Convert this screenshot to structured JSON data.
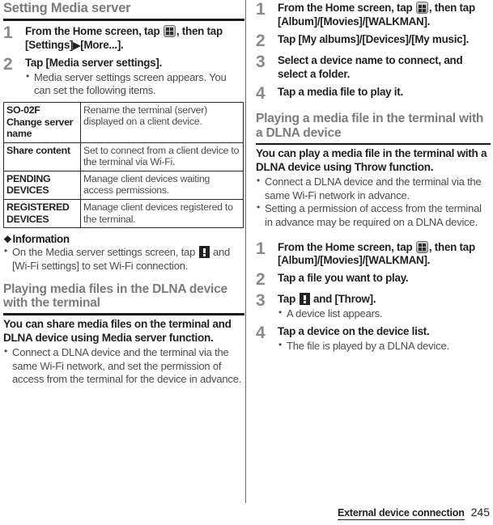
{
  "left_column": {
    "section_title": "Setting Media server",
    "steps": [
      {
        "num": "1",
        "text_parts": {
          "before_icon": "From the Home screen, tap ",
          "icon": "apps-grid-icon",
          "after_icon": ", then tap [Settings]",
          "arrow": "▶",
          "tail": "[More...]."
        }
      },
      {
        "num": "2",
        "text": "Tap [Media server settings].",
        "bullets": [
          "Media server settings screen appears. You can set the following items."
        ]
      }
    ],
    "table": {
      "rows": [
        {
          "key": "SO-02F Change server name",
          "value": "Rename the terminal (server) displayed on a client device."
        },
        {
          "key": "Share content",
          "value": "Set to connect from a client device to the terminal via Wi-Fi."
        },
        {
          "key": "PENDING DEVICES",
          "value": "Manage client devices waiting access permissions."
        },
        {
          "key": "REGISTERED DEVICES",
          "value": "Manage client devices registered to the terminal."
        }
      ]
    },
    "information": {
      "heading": "Information",
      "diamond": "❖",
      "bullet_parts": {
        "before_icon": "On the Media server settings screen, tap ",
        "icon": "overflow-menu-icon",
        "after_icon": " and [Wi-Fi settings] to set Wi-Fi connection."
      }
    },
    "subsection": {
      "title": "Playing media files in the DLNA device with the terminal",
      "intro": "You can share media files on the terminal and DLNA device using Media server function.",
      "bullets": [
        "Connect a DLNA device and the terminal via the same Wi-Fi network, and set the permission of access from the terminal for the device in advance."
      ]
    }
  },
  "right_column": {
    "steps_top": [
      {
        "num": "1",
        "text_parts": {
          "before_icon": "From the Home screen, tap ",
          "icon": "apps-grid-icon",
          "after_icon": ", then tap [Album]/[Movies]/[WALKMAN]."
        }
      },
      {
        "num": "2",
        "text": "Tap [My albums]/[Devices]/[My music]."
      },
      {
        "num": "3",
        "text": "Select a device name to connect, and select a folder."
      },
      {
        "num": "4",
        "text": "Tap a media file to play it."
      }
    ],
    "subsection": {
      "title": "Playing a media file in the terminal with a DLNA device",
      "intro": "You can play a media file in the terminal with a DLNA device using Throw function.",
      "bullets": [
        "Connect a DLNA device and the terminal via the same Wi-Fi network in advance.",
        "Setting a permission of access from the terminal in advance may be required on a DLNA device."
      ]
    },
    "steps_bottom": [
      {
        "num": "1",
        "text_parts": {
          "before_icon": "From the Home screen, tap ",
          "icon": "apps-grid-icon",
          "after_icon": ", then tap [Album]/[Movies]/[WALKMAN]."
        }
      },
      {
        "num": "2",
        "text": "Tap a file you want to play."
      },
      {
        "num": "3",
        "text_parts": {
          "before_icon": "Tap ",
          "icon": "overflow-menu-icon",
          "after_icon": " and [Throw]."
        },
        "bullets": [
          "A device list appears."
        ]
      },
      {
        "num": "4",
        "text": "Tap a device on the device list.",
        "bullets": [
          "The file is played by a DLNA device."
        ]
      }
    ]
  },
  "footer": {
    "label": "External device connection",
    "page_number": "245"
  },
  "colors": {
    "heading_gray": "#7b7b7b",
    "step_number_gray": "#8a8a8a",
    "body_black": "#231f20",
    "bullet_gray": "#4b4b4b",
    "rule_black": "#1a1a1a"
  }
}
